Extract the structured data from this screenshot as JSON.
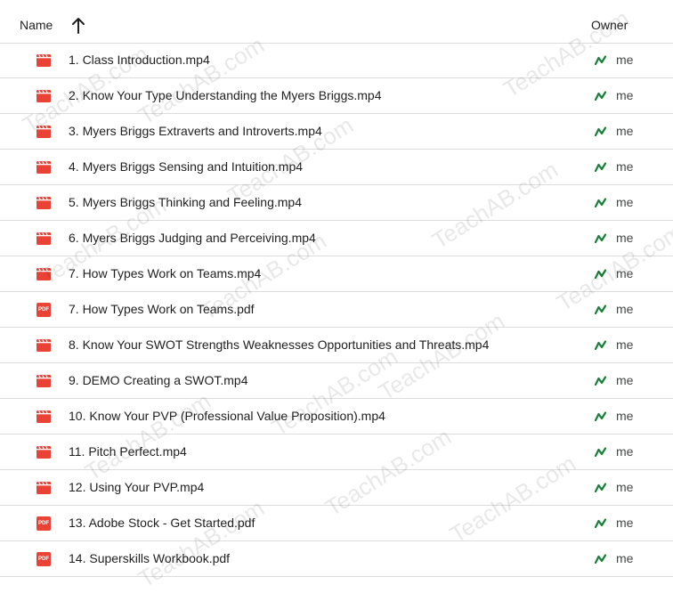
{
  "header": {
    "name_label": "Name",
    "sort_icon": "arrow-up-icon",
    "owner_label": "Owner"
  },
  "files": [
    {
      "name": "1. Class Introduction.mp4",
      "type": "video",
      "owner": "me"
    },
    {
      "name": "2. Know Your Type Understanding the Myers Briggs.mp4",
      "type": "video",
      "owner": "me"
    },
    {
      "name": "3. Myers Briggs Extraverts and Introverts.mp4",
      "type": "video",
      "owner": "me"
    },
    {
      "name": "4. Myers Briggs Sensing and Intuition.mp4",
      "type": "video",
      "owner": "me"
    },
    {
      "name": "5. Myers Briggs Thinking and Feeling.mp4",
      "type": "video",
      "owner": "me"
    },
    {
      "name": "6. Myers Briggs Judging and Perceiving.mp4",
      "type": "video",
      "owner": "me"
    },
    {
      "name": "7. How Types Work on Teams.mp4",
      "type": "video",
      "owner": "me"
    },
    {
      "name": "7. How Types Work on Teams.pdf",
      "type": "pdf",
      "owner": "me"
    },
    {
      "name": "8. Know Your SWOT Strengths Weaknesses Opportunities and Threats.mp4",
      "type": "video",
      "owner": "me"
    },
    {
      "name": "9. DEMO Creating a SWOT.mp4",
      "type": "video",
      "owner": "me"
    },
    {
      "name": "10. Know Your PVP (Professional Value Proposition).mp4",
      "type": "video",
      "owner": "me"
    },
    {
      "name": "11. Pitch Perfect.mp4",
      "type": "video",
      "owner": "me"
    },
    {
      "name": "12. Using Your PVP.mp4",
      "type": "video",
      "owner": "me"
    },
    {
      "name": "13. Adobe Stock - Get Started.pdf",
      "type": "pdf",
      "owner": "me"
    },
    {
      "name": "14. Superskills Workbook.pdf",
      "type": "pdf",
      "owner": "me"
    }
  ],
  "pdf_badge_text": "PDF",
  "watermark": "TeachAB.com",
  "colors": {
    "video_icon": "#ea4335",
    "pdf_icon": "#ea4335",
    "owner_icon": "#188038",
    "divider": "#dadce0"
  }
}
